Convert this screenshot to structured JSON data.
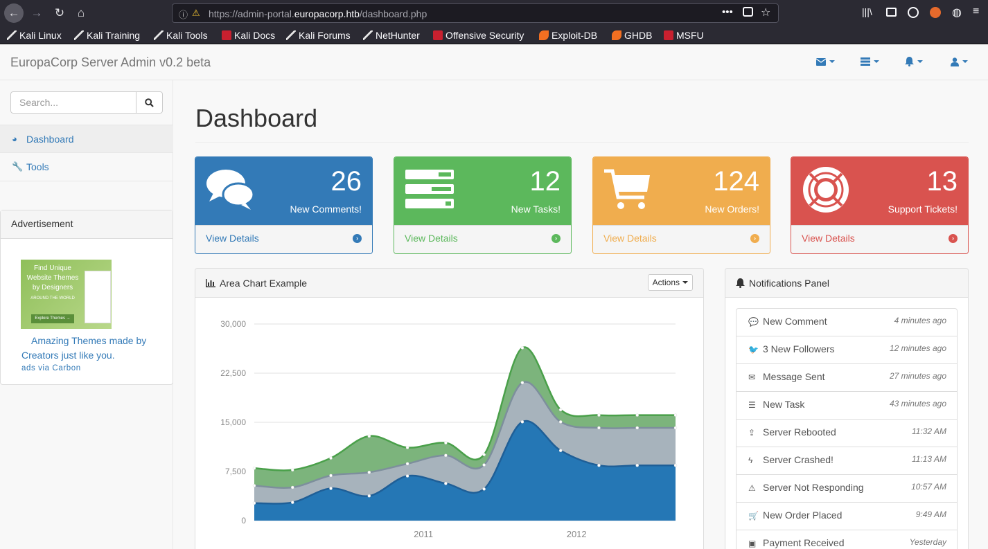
{
  "browser": {
    "url_prefix": "https://admin-portal.",
    "url_domain": "europacorp.htb",
    "url_path": "/dashboard.php",
    "bookmarks": [
      {
        "label": "Kali Linux",
        "icon": "kali-dragon-icon"
      },
      {
        "label": "Kali Training",
        "icon": "kali-dragon-icon"
      },
      {
        "label": "Kali Tools",
        "icon": "kali-dragon-icon"
      },
      {
        "label": "Kali Docs",
        "icon": "kali-docs-icon"
      },
      {
        "label": "Kali Forums",
        "icon": "kali-dragon-icon"
      },
      {
        "label": "NetHunter",
        "icon": "kali-dragon-icon"
      },
      {
        "label": "Offensive Security",
        "icon": "offsec-icon"
      },
      {
        "label": "Exploit-DB",
        "icon": "exploitdb-icon"
      },
      {
        "label": "GHDB",
        "icon": "exploitdb-icon"
      },
      {
        "label": "MSFU",
        "icon": "offsec-icon"
      }
    ]
  },
  "navbar": {
    "brand": "EuropaCorp Server Admin v0.2 beta",
    "dropdowns": [
      "envelope-icon",
      "tasks-icon",
      "bell-icon",
      "user-icon"
    ],
    "accent": "#337ab7"
  },
  "sidebar": {
    "search_placeholder": "Search...",
    "items": [
      {
        "label": "Dashboard",
        "icon": "dashboard-icon",
        "active": true
      },
      {
        "label": "Tools",
        "icon": "wrench-icon",
        "active": false
      }
    ],
    "ad": {
      "heading": "Advertisement",
      "image_text": "Find Unique Website Themes by Designers",
      "image_subtext": "AROUND THE WORLD",
      "image_button": "Explore Themes →",
      "text": "Amazing Themes made by Creators just like you.",
      "via": "ads via Carbon"
    }
  },
  "main": {
    "title": "Dashboard",
    "stats": [
      {
        "value": "26",
        "label": "New Comments!",
        "link": "View Details",
        "color": "#337ab7",
        "icon": "comments-icon"
      },
      {
        "value": "12",
        "label": "New Tasks!",
        "link": "View Details",
        "color": "#5cb85c",
        "icon": "tasks-icon"
      },
      {
        "value": "124",
        "label": "New Orders!",
        "link": "View Details",
        "color": "#f0ad4e",
        "icon": "shopping-cart-icon"
      },
      {
        "value": "13",
        "label": "Support Tickets!",
        "link": "View Details",
        "color": "#d9534f",
        "icon": "life-ring-icon"
      }
    ],
    "chart_panel": {
      "title": "Area Chart Example",
      "actions_label": "Actions"
    },
    "notifications": {
      "title": "Notifications Panel",
      "items": [
        {
          "label": "New Comment",
          "time": "4 minutes ago",
          "icon": "comment-icon"
        },
        {
          "label": "3 New Followers",
          "time": "12 minutes ago",
          "icon": "twitter-icon"
        },
        {
          "label": "Message Sent",
          "time": "27 minutes ago",
          "icon": "envelope-icon"
        },
        {
          "label": "New Task",
          "time": "43 minutes ago",
          "icon": "tasks-icon"
        },
        {
          "label": "Server Rebooted",
          "time": "11:32 AM",
          "icon": "upload-icon"
        },
        {
          "label": "Server Crashed!",
          "time": "11:13 AM",
          "icon": "bolt-icon"
        },
        {
          "label": "Server Not Responding",
          "time": "10:57 AM",
          "icon": "warning-icon"
        },
        {
          "label": "New Order Placed",
          "time": "9:49 AM",
          "icon": "shopping-cart-icon"
        },
        {
          "label": "Payment Received",
          "time": "Yesterday",
          "icon": "money-icon"
        }
      ]
    }
  },
  "chart_data": {
    "type": "area",
    "stacked": true,
    "x": [
      "2010-Q1",
      "2010-Q2",
      "2010-Q3",
      "2010-Q4",
      "2011-Q1",
      "2011-Q2",
      "2011-Q3",
      "2011-Q4",
      "2012-Q1",
      "2012-Q2",
      "2012-Q3",
      "2012-Q4"
    ],
    "x_tick_labels": [
      "2011",
      "2012"
    ],
    "x_tick_positions": [
      "2011-Q1",
      "2012-Q1"
    ],
    "ylim": [
      0,
      30000
    ],
    "y_ticks": [
      "0",
      "7,500",
      "15,000",
      "22,500",
      "30,000"
    ],
    "y_tick_values": [
      0,
      7500,
      15000,
      22500,
      30000
    ],
    "grid": "horizontal",
    "series": [
      {
        "color": "#2577b5",
        "values": [
          2670,
          2780,
          4910,
          3770,
          6810,
          5670,
          4820,
          15070,
          10690,
          8430,
          8430,
          8430
        ]
      },
      {
        "color": "#a7b3bc",
        "values": [
          2670,
          2290,
          1970,
          3600,
          1870,
          4280,
          3680,
          5980,
          4380,
          5720,
          5720,
          5720
        ]
      },
      {
        "color": "#7cb47c",
        "values": [
          2666,
          2666,
          2666,
          5530,
          2470,
          1920,
          1570,
          5310,
          1850,
          1950,
          1950,
          1950
        ]
      }
    ]
  }
}
